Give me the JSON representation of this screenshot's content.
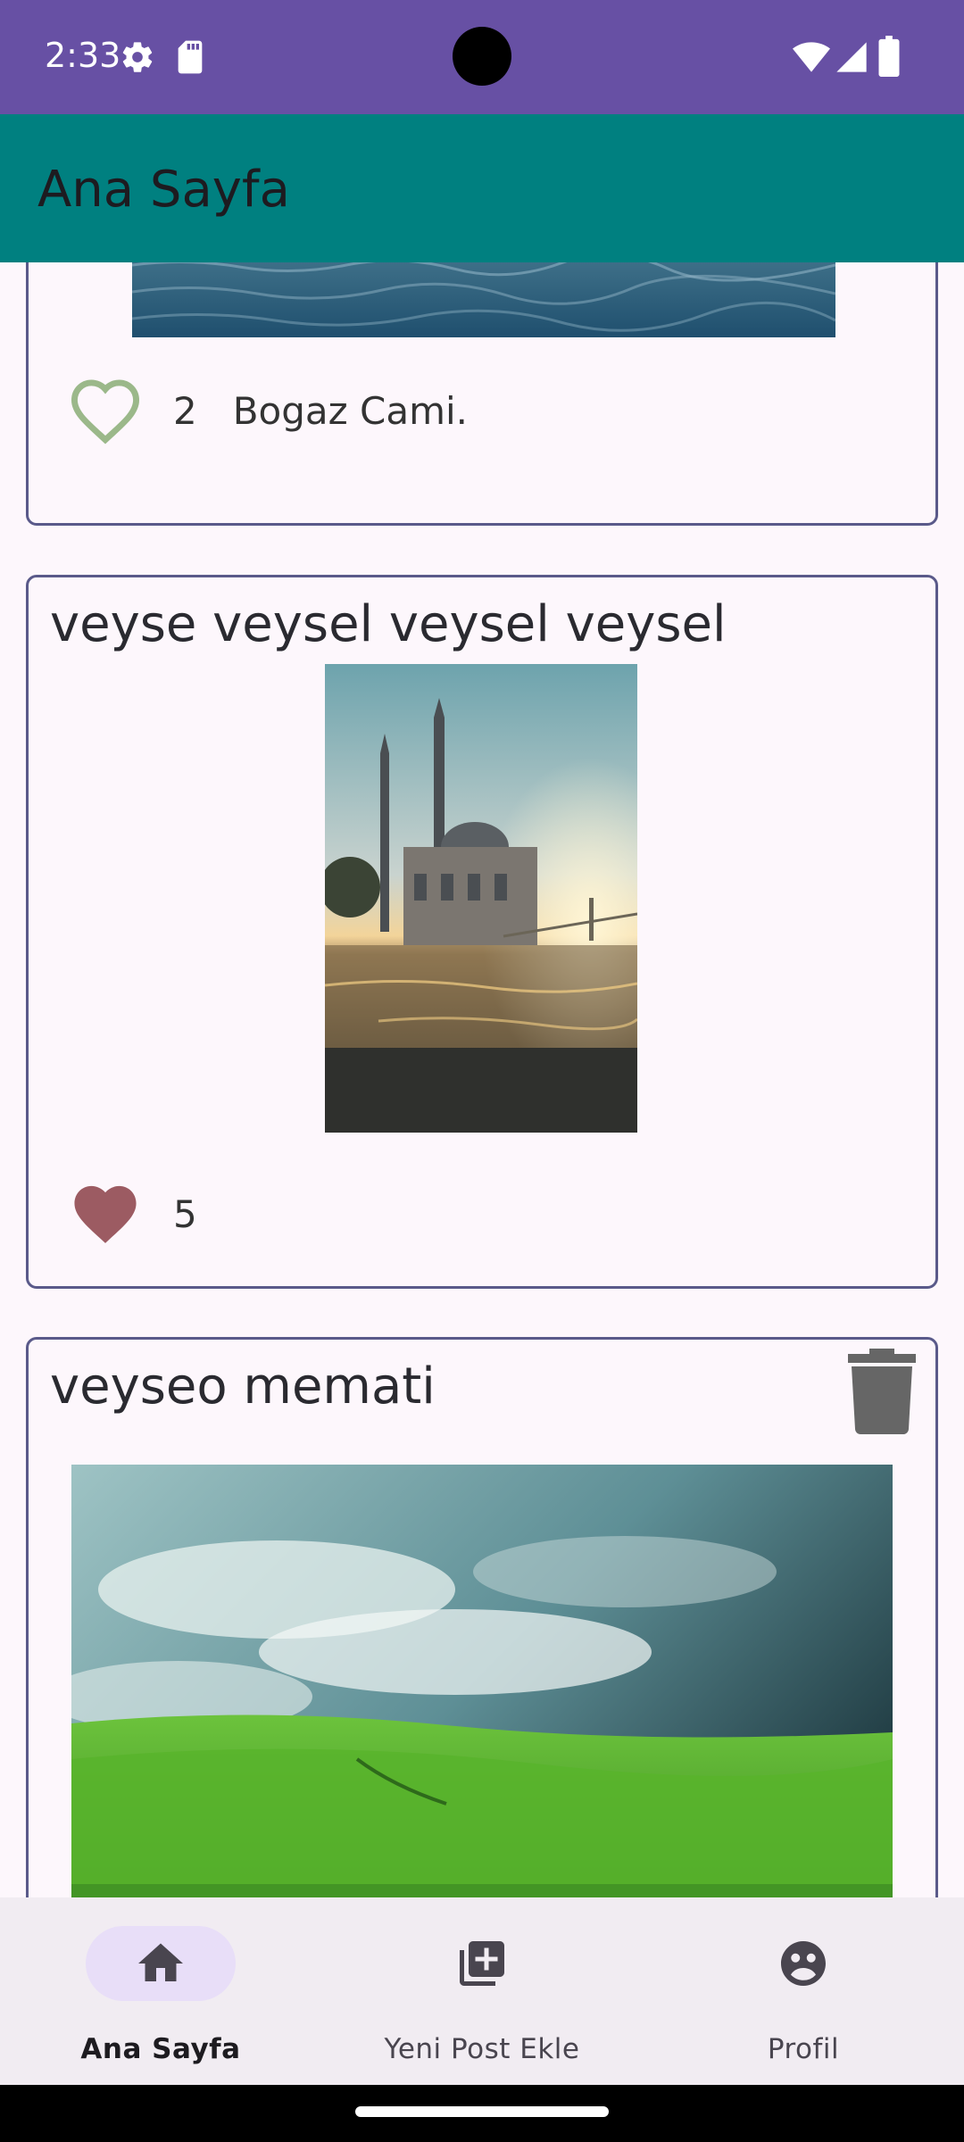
{
  "status_bar": {
    "time": "2:33",
    "icons": [
      "settings-icon",
      "sd-card-icon",
      "wifi-icon",
      "signal-icon",
      "battery-icon"
    ]
  },
  "app_bar": {
    "title": "Ana Sayfa"
  },
  "posts": [
    {
      "title": "",
      "likes": "2",
      "caption": "Bogaz Cami.",
      "liked": false,
      "image": "bosphorus-water-photo"
    },
    {
      "title": "veyse veysel veysel veysel",
      "likes": "5",
      "caption": "",
      "liked": true,
      "image": "ortakoy-mosque-sunset-photo"
    },
    {
      "title": "veyseo memati",
      "deletable": true,
      "image": "green-meadow-sky-photo"
    }
  ],
  "bottom_nav": {
    "items": [
      {
        "label": "Ana Sayfa",
        "icon": "home-icon",
        "active": true
      },
      {
        "label": "Yeni Post Ekle",
        "icon": "add-post-icon",
        "active": false
      },
      {
        "label": "Profil",
        "icon": "profile-icon",
        "active": false
      }
    ]
  },
  "colors": {
    "status_bar": "#6750a4",
    "app_bar": "#008080",
    "liked_heart": "#9c5b62",
    "unliked_heart": "#9bb88a",
    "nav_active_pill": "#e8def8"
  }
}
